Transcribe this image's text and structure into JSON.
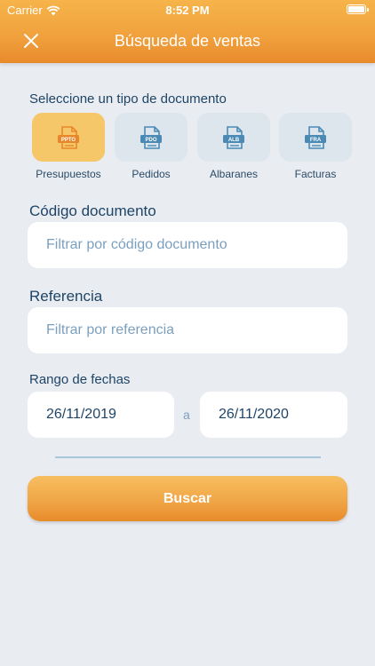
{
  "status_bar": {
    "carrier": "Carrier",
    "time": "8:52 PM"
  },
  "header": {
    "title": "Búsqueda de ventas",
    "close_icon": "close-icon"
  },
  "document_type": {
    "label": "Seleccione un tipo de documento",
    "selected": "PPTO",
    "options": [
      {
        "code": "PPTO",
        "label": "Presupuestos",
        "selected": true
      },
      {
        "code": "PDO",
        "label": "Pedidos",
        "selected": false
      },
      {
        "code": "ALB",
        "label": "Albaranes",
        "selected": false
      },
      {
        "code": "FRA",
        "label": "Facturas",
        "selected": false
      }
    ]
  },
  "codigo": {
    "label": "Código documento",
    "placeholder": "Filtrar por código documento",
    "value": ""
  },
  "referencia": {
    "label": "Referencia",
    "placeholder": "Filtrar por referencia",
    "value": ""
  },
  "fechas": {
    "label": "Rango de fechas",
    "from": "26/11/2019",
    "separator": "a",
    "to": "26/11/2020"
  },
  "search_button": {
    "label": "Buscar"
  },
  "colors": {
    "accent": "#f0a03c",
    "selected_tile": "#f6c768",
    "tile": "#dde6ed",
    "text_dark": "#1f4466",
    "placeholder": "#7b9fbf",
    "icon_blue": "#4a8ab5",
    "icon_orange": "#e8872a"
  }
}
